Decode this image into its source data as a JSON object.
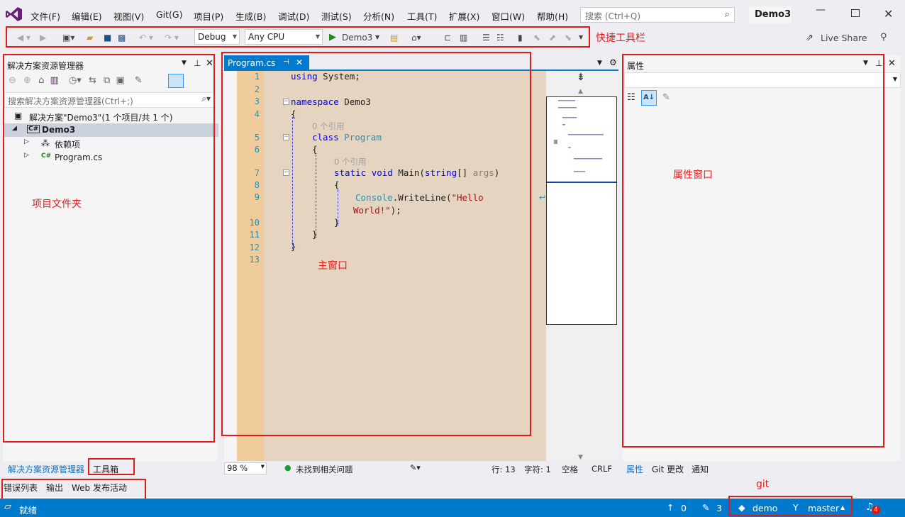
{
  "menubar": {
    "items": [
      "文件(F)",
      "编辑(E)",
      "视图(V)",
      "Git(G)",
      "项目(P)",
      "生成(B)",
      "调试(D)",
      "测试(S)",
      "分析(N)",
      "工具(T)",
      "扩展(X)",
      "窗口(W)",
      "帮助(H)"
    ],
    "search_placeholder": "搜索 (Ctrl+Q)",
    "project_name": "Demo3"
  },
  "toolbar": {
    "config": "Debug",
    "platform": "Any CPU",
    "run_target": "Demo3",
    "live_share": "Live Share",
    "annotation": "快捷工具栏"
  },
  "solution_explorer": {
    "title": "解决方案资源管理器",
    "search_placeholder": "搜索解决方案资源管理器(Ctrl+;)",
    "solution_label": "解决方案\"Demo3\"(1 个项目/共 1 个)",
    "project": "Demo3",
    "items": [
      "依赖项",
      "Program.cs"
    ],
    "annotation": "项目文件夹",
    "bottom_tabs": [
      "解决方案资源管理器",
      "工具箱"
    ]
  },
  "editor": {
    "tab": "Program.cs",
    "line_numbers": [
      "1",
      "2",
      "3",
      "4",
      "5",
      "6",
      "7",
      "8",
      "9",
      "10",
      "11",
      "12",
      "13"
    ],
    "code": {
      "l1_kw": "using",
      "l1_rest": " System;",
      "l3_kw": "namespace",
      "l3_rest": " Demo3",
      "l4": "{",
      "refs_class": "0 个引用",
      "l5_kw": "class",
      "l5_type": "Program",
      "l6": "{",
      "refs_main": "0 个引用",
      "l7_kw1": "static",
      "l7_kw2": "void",
      "l7_name": " Main(",
      "l7_kw3": "string",
      "l7_rest": "[] ",
      "l7_arg": "args",
      "l7_close": ")",
      "l8": "{",
      "l9_type": "Console",
      "l9_mid": ".WriteLine(",
      "l9_str": "\"Hello",
      "l9b_str": "World!\"",
      "l9b_rest": ");",
      "l10": "}",
      "l11": "}",
      "l12": "}"
    },
    "annotation": "主窗口",
    "status": {
      "zoom": "98 %",
      "issues": "未找到相关问题",
      "line": "行: 13",
      "char": "字符: 1",
      "spaces": "空格",
      "eol": "CRLF"
    }
  },
  "properties": {
    "title": "属性",
    "annotation": "属性窗口",
    "bottom_tabs": [
      "属性",
      "Git 更改",
      "通知"
    ]
  },
  "bottom_tabs": [
    "错误列表",
    "输出",
    "Web 发布活动"
  ],
  "statusbar": {
    "ready": "就绪",
    "up_count": "0",
    "pencil_count": "3",
    "repo": "demo",
    "branch": "master",
    "notifications": "4",
    "git_annotation": "git"
  },
  "colors": {
    "accent": "#007acc",
    "annotation_red": "#e31b1b",
    "editor_bg": "#e4d4c0",
    "gutter_bg": "#f0cc9c"
  }
}
